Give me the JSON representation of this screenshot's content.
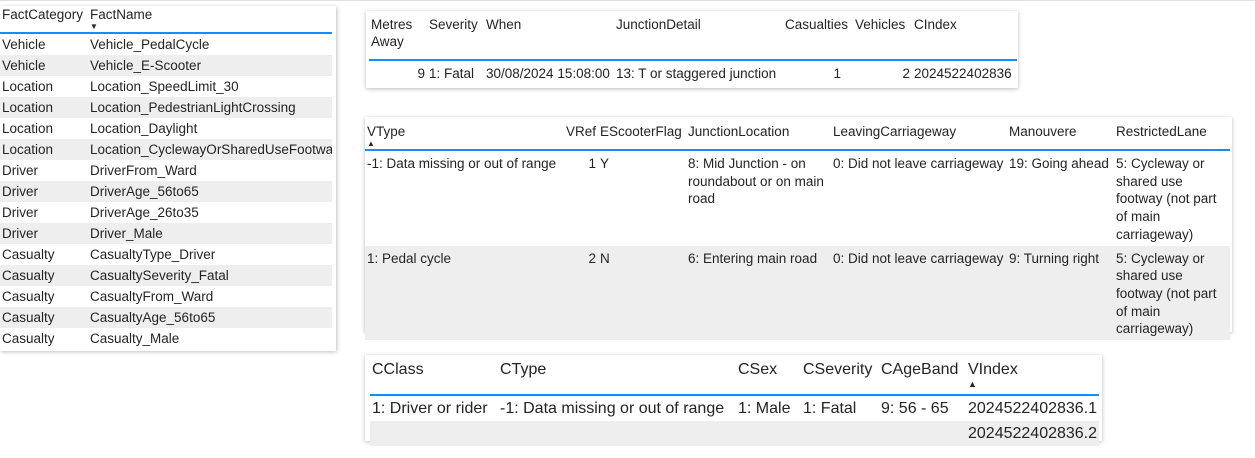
{
  "facts": {
    "columns": [
      "FactCategory",
      "FactName"
    ],
    "sorted_column": "FactName",
    "rows": [
      [
        "Vehicle",
        "Vehicle_PedalCycle"
      ],
      [
        "Vehicle",
        "Vehicle_E-Scooter"
      ],
      [
        "Location",
        "Location_SpeedLimit_30"
      ],
      [
        "Location",
        "Location_PedestrianLightCrossing"
      ],
      [
        "Location",
        "Location_Daylight"
      ],
      [
        "Location",
        "Location_CyclewayOrSharedUseFootway"
      ],
      [
        "Driver",
        "DriverFrom_Ward"
      ],
      [
        "Driver",
        "DriverAge_56to65"
      ],
      [
        "Driver",
        "DriverAge_26to35"
      ],
      [
        "Driver",
        "Driver_Male"
      ],
      [
        "Casualty",
        "CasualtyType_Driver"
      ],
      [
        "Casualty",
        "CasualtySeverity_Fatal"
      ],
      [
        "Casualty",
        "CasualtyFrom_Ward"
      ],
      [
        "Casualty",
        "CasualtyAge_56to65"
      ],
      [
        "Casualty",
        "Casualty_Male"
      ]
    ]
  },
  "accident": {
    "columns": [
      "Metres Away",
      "Severity",
      "When",
      "JunctionDetail",
      "Casualties",
      "Vehicles",
      "CIndex"
    ],
    "rows": [
      [
        "9",
        "1: Fatal",
        "30/08/2024 15:08:00",
        "13: T or staggered junction",
        "1",
        "2",
        "2024522402836"
      ]
    ]
  },
  "vehicles": {
    "columns": [
      "VType",
      "VRef",
      "EScooterFlag",
      "JunctionLocation",
      "LeavingCarriageway",
      "Manouvere",
      "RestrictedLane"
    ],
    "sorted_column": "VType",
    "rows": [
      [
        "-1: Data missing or out of range",
        "1",
        "Y",
        "8: Mid Junction - on roundabout or on main road",
        "0: Did not leave carriageway",
        "19: Going ahead",
        "5: Cycleway or shared use footway (not part of main carriageway)"
      ],
      [
        "1: Pedal cycle",
        "2",
        "N",
        "6: Entering main road",
        "0: Did not leave carriageway",
        "9: Turning right",
        "5: Cycleway or shared use footway (not part of main carriageway)"
      ]
    ]
  },
  "casualty": {
    "columns": [
      "CClass",
      "CType",
      "CSex",
      "CSeverity",
      "CAgeBand",
      "VIndex"
    ],
    "sorted_column": "VIndex",
    "rows": [
      [
        "1: Driver or rider",
        "-1: Data missing or out of range",
        "1: Male",
        "1: Fatal",
        "9: 56 - 65",
        "2024522402836.1"
      ],
      [
        "",
        "",
        "",
        "",
        "",
        "2024522402836.2"
      ]
    ]
  },
  "colors": {
    "header_underline": "#118dff",
    "alt_row": "#eeeeee"
  },
  "icons": {
    "sort": "sort-ascending-arrow-icon"
  }
}
